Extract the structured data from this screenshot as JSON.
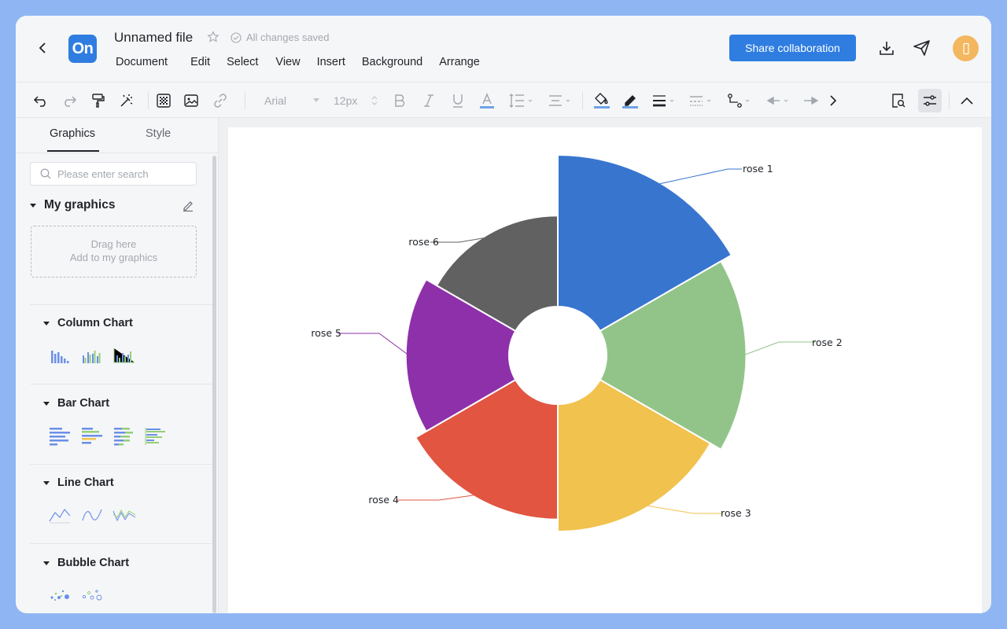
{
  "header": {
    "file_title": "Unnamed file",
    "saved_status": "All changes saved",
    "logo_text": "On",
    "menu": [
      "Document",
      "Edit",
      "Select",
      "View",
      "Insert",
      "Background",
      "Arrange"
    ],
    "share_label": "Share collaboration"
  },
  "toolbar": {
    "font_family": "Arial",
    "font_size": "12px"
  },
  "left_panel": {
    "tabs": [
      "Graphics",
      "Style"
    ],
    "search_placeholder": "Please enter search",
    "my_graphics": {
      "title": "My graphics",
      "drop_line1": "Drag here",
      "drop_line2": "Add to my graphics"
    },
    "categories": [
      "Column Chart",
      "Bar Chart",
      "Line Chart",
      "Bubble Chart"
    ]
  },
  "colors": {
    "accent": "#2f7de1",
    "rose_1": "#3875cf",
    "rose_2": "#92c48a",
    "rose_3": "#f2c24f",
    "rose_4": "#e15541",
    "rose_5": "#8e30aa",
    "rose_6": "#616161"
  },
  "chart_data": {
    "type": "pie",
    "variant": "nightingale-rose",
    "categories": [
      "rose 1",
      "rose 2",
      "rose 3",
      "rose 4",
      "rose 5",
      "rose 6"
    ],
    "values": [
      100,
      92,
      84,
      76,
      68,
      60
    ],
    "title": "",
    "legend": "none",
    "data_labels": "outside with leader lines"
  }
}
